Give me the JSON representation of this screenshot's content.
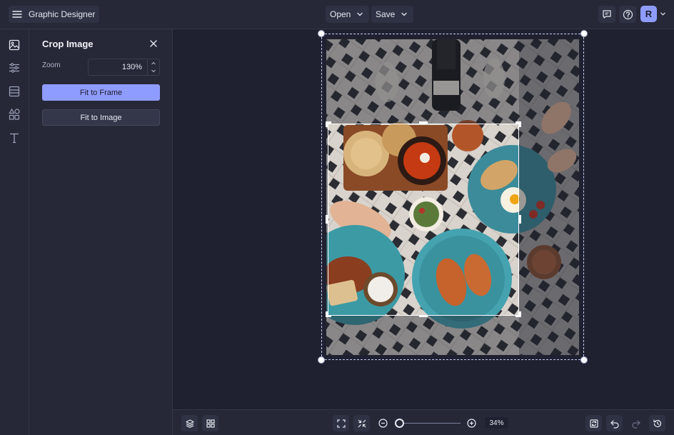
{
  "app": {
    "title": "Graphic Designer"
  },
  "topbar": {
    "menu_icon": "hamburger-menu-icon",
    "open_label": "Open",
    "save_label": "Save",
    "comments_icon": "comment-icon",
    "help_icon": "help-icon",
    "avatar_initial": "R"
  },
  "rail": {
    "items": [
      {
        "icon": "image-icon"
      },
      {
        "icon": "adjustments-icon"
      },
      {
        "icon": "layout-icon"
      },
      {
        "icon": "shapes-icon"
      },
      {
        "icon": "text-icon"
      }
    ]
  },
  "panel": {
    "title": "Crop Image",
    "zoom_label": "Zoom",
    "zoom_value": "130",
    "zoom_unit": "%",
    "fit_to_frame": "Fit to Frame",
    "fit_to_image": "Fit to Image"
  },
  "bottombar": {
    "zoom_level": "34%",
    "zoom_slider_fraction": 0.0
  },
  "colors": {
    "accent": "#8f9cff",
    "background": "#1f2130",
    "panel": "#262838"
  }
}
